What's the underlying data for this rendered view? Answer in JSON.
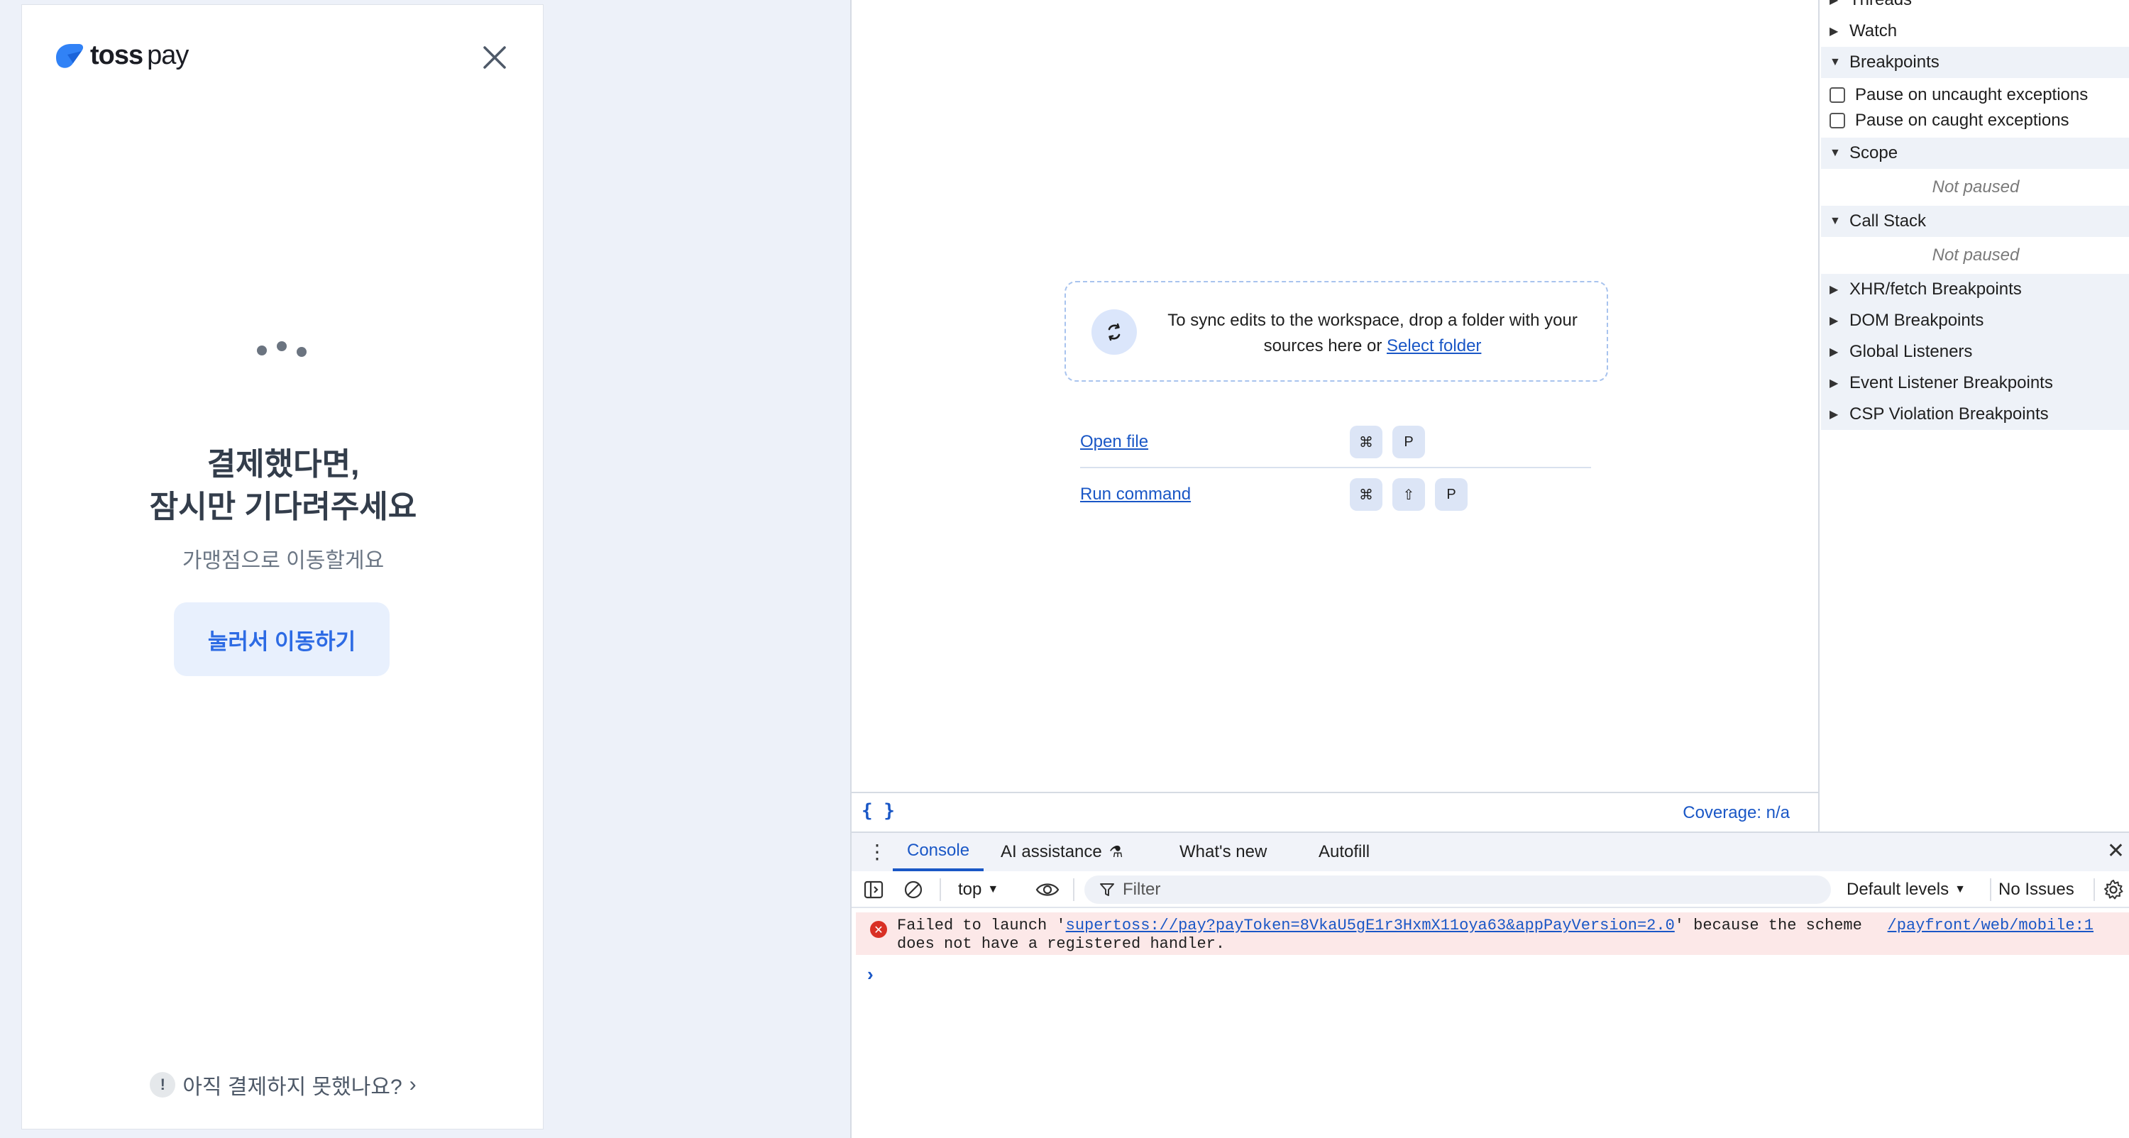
{
  "toss": {
    "logo_text": "toss",
    "logo_pay": "pay",
    "title_line1": "결제했다면,",
    "title_line2": "잠시만 기다려주세요",
    "subtitle": "가맹점으로 이동할게요",
    "button_label": "눌러서 이동하기",
    "help_text": "아직 결제하지 못했나요?",
    "colors": {
      "accent": "#3182f6",
      "button_bg": "#e8f0fd",
      "button_text": "#2d6be4"
    }
  },
  "editor": {
    "dropzone_text": "To sync edits to the workspace, drop a folder with your sources here or",
    "select_folder_link": "Select folder",
    "open_file_label": "Open file",
    "open_file_keys": [
      "⌘",
      "P"
    ],
    "run_command_label": "Run command",
    "run_command_keys": [
      "⌘",
      "⇧",
      "P"
    ],
    "braces_icon": "{ }",
    "coverage": "Coverage: n/a"
  },
  "debug": {
    "sections": [
      {
        "label": "Threads",
        "open": false
      },
      {
        "label": "Watch",
        "open": false
      },
      {
        "label": "Breakpoints",
        "open": true
      },
      {
        "label": "Scope",
        "open": true
      },
      {
        "label": "Call Stack",
        "open": true
      },
      {
        "label": "XHR/fetch Breakpoints",
        "open": false
      },
      {
        "label": "DOM Breakpoints",
        "open": false
      },
      {
        "label": "Global Listeners",
        "open": false
      },
      {
        "label": "Event Listener Breakpoints",
        "open": false
      },
      {
        "label": "CSP Violation Breakpoints",
        "open": false
      }
    ],
    "pause_uncaught": "Pause on uncaught exceptions",
    "pause_caught": "Pause on caught exceptions",
    "scope_status": "Not paused",
    "callstack_status": "Not paused"
  },
  "drawer": {
    "tabs": [
      "Console",
      "AI assistance",
      "What's new",
      "Autofill"
    ],
    "active_tab": "Console",
    "context": "top",
    "filter_placeholder": "Filter",
    "levels": "Default levels",
    "issues": "No Issues",
    "error": {
      "prefix": "Failed to launch '",
      "url": "supertoss://pay?payToken=8VkaU5gE1r3HxmX11oya63&appPayVersion=2.0",
      "suffix": "' because the scheme",
      "line2": "does not have a registered handler.",
      "source": "/payfront/web/mobile:1"
    },
    "prompt": "›"
  }
}
